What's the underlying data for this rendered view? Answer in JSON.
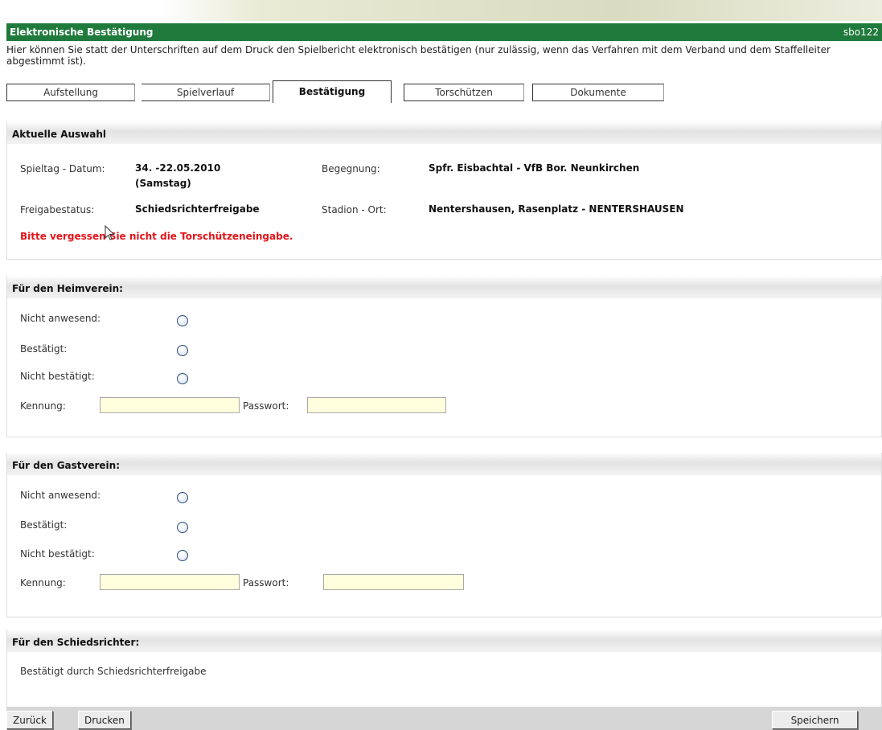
{
  "header": {
    "title": "Elektronische Bestätigung",
    "code": "sbo122"
  },
  "intro": "Hier können Sie statt der Unterschriften auf dem Druck den Spielbericht elektronisch bestätigen (nur zulässig, wenn das Verfahren mit dem Verband und dem Staffelleiter abgestimmt ist).",
  "tabs": [
    {
      "label": "Aufstellung"
    },
    {
      "label": "Spielverlauf"
    },
    {
      "label": "Bestätigung",
      "active": true
    },
    {
      "label": "Torschützen"
    },
    {
      "label": "Dokumente"
    }
  ],
  "selection": {
    "heading": "Aktuelle Auswahl",
    "matchday_label": "Spieltag - Datum:",
    "matchday_value": "34. -22.05.2010",
    "matchday_value2": "(Samstag)",
    "fixture_label": "Begegnung:",
    "fixture_value": "Spfr. Eisbachtal - VfB Bor. Neunkirchen",
    "status_label": "Freigabestatus:",
    "status_value": "Schiedsrichterfreigabe",
    "venue_label": "Stadion - Ort:",
    "venue_value": "Nentershausen, Rasenplatz - NENTERSHAUSEN",
    "warning": "Bitte vergessen Sie nicht die Torschützeneingabe."
  },
  "home": {
    "heading": "Für den Heimverein:",
    "opt_absent": "Nicht anwesend:",
    "opt_confirmed": "Bestätigt:",
    "opt_not_confirmed": "Nicht bestätigt:",
    "id_label": "Kennung:",
    "id_value": "",
    "pw_label": "Passwort:",
    "pw_value": ""
  },
  "guest": {
    "heading": "Für den Gastverein:",
    "opt_absent": "Nicht anwesend:",
    "opt_confirmed": "Bestätigt:",
    "opt_not_confirmed": "Nicht bestätigt:",
    "id_label": "Kennung:",
    "id_value": "",
    "pw_label": "Passwort:",
    "pw_value": ""
  },
  "referee": {
    "heading": "Für den Schiedsrichter:",
    "text": "Bestätigt durch Schiedsrichterfreigabe"
  },
  "footer": {
    "back": "Zurück",
    "print": "Drucken",
    "save": "Speichern"
  },
  "colors": {
    "titlebar": "#1f7a3b",
    "warning": "#e3141a",
    "input_bg": "#ffffdd"
  }
}
